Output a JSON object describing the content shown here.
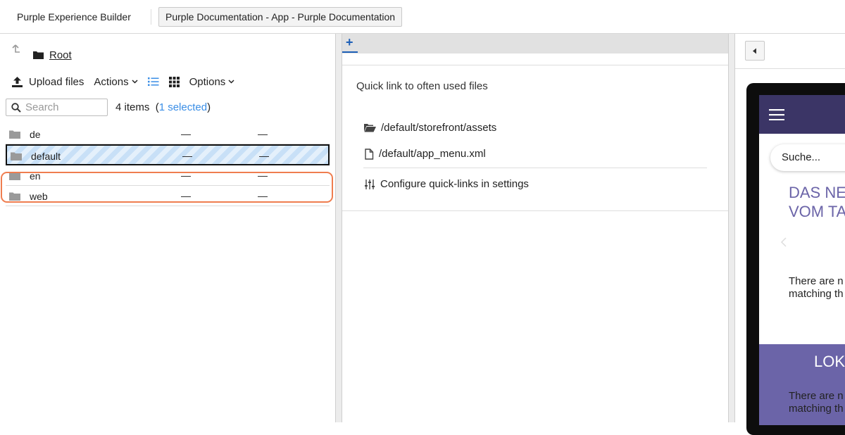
{
  "topbar": {
    "app_title": "Purple Experience Builder",
    "document_button": "Purple Documentation - App - Purple Documentation"
  },
  "left": {
    "root_label": "Root",
    "toolbar": {
      "upload_label": "Upload files",
      "actions_label": "Actions",
      "options_label": "Options"
    },
    "search": {
      "placeholder": "Search",
      "value": ""
    },
    "items_count": "4 items",
    "selected_text": "1 selected",
    "files": [
      {
        "name": "de",
        "col2": "—",
        "col3": "—",
        "selected": false
      },
      {
        "name": "default",
        "col2": "—",
        "col3": "—",
        "selected": true
      },
      {
        "name": "en",
        "col2": "—",
        "col3": "—",
        "selected": false
      },
      {
        "name": "web",
        "col2": "—",
        "col3": "—",
        "selected": false
      }
    ]
  },
  "middle": {
    "tab_plus": "+",
    "heading": "Quick link to often used files",
    "links": [
      {
        "icon": "folder-open-icon",
        "label": "/default/storefront/assets"
      },
      {
        "icon": "file-icon",
        "label": "/default/app_menu.xml"
      }
    ],
    "configure_label": "Configure quick-links in settings"
  },
  "preview": {
    "search_placeholder": "Suche...",
    "headline": "DAS NE\nVOM TA",
    "no_match_1": "There are n\nmatching th",
    "band_title": "LOK",
    "no_match_2": "There are n\nmatching th",
    "colors": {
      "header": "#3b3566",
      "accent": "#6b64a8"
    }
  },
  "colors": {
    "link_blue": "#3a8ee6",
    "focus_ring": "#ef7d4f",
    "tab_blue": "#1d5fb7"
  }
}
